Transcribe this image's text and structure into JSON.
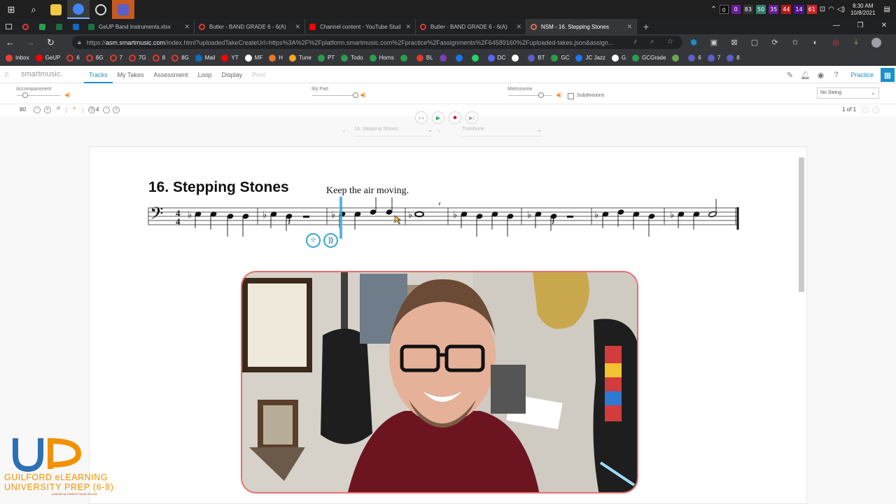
{
  "taskbar": {
    "tray_badges": [
      "0",
      "0",
      "83",
      "50",
      "35",
      "44",
      "14",
      "61"
    ],
    "time": "8:30 AM",
    "date": "10/8/2021"
  },
  "tabs": [
    {
      "title": "GeUP Band Instruments.xlsx",
      "color": "#1d6f42"
    },
    {
      "title": "Butler - BAND GRADE 6 - 6(A)",
      "color": "#e0392c"
    },
    {
      "title": "Channel content - YouTube Stud",
      "color": "#ff0000"
    },
    {
      "title": "Butler - BAND GRADE 6 - 6(A)",
      "color": "#e0392c"
    },
    {
      "title": "NSM - 16. Stepping Stones",
      "color": "#e06e4a",
      "active": true
    }
  ],
  "address": {
    "host": "asm.smartmusic.com",
    "prefix": "https://",
    "path": "/index.html?uploadedTakeCreateUrl=https%3A%2F%2Fplatform.smartmusic.com%2Fpractice%2Fassignments%2F64589160%2Fuploaded-takes.json&assign..."
  },
  "bookmarks": [
    {
      "label": "Inbox",
      "color": "#ea4335"
    },
    {
      "label": "GeUP",
      "color": "#ff0000"
    },
    {
      "label": "6",
      "color": "#e0392c",
      "ring": true
    },
    {
      "label": "6G",
      "color": "#e0392c",
      "ring": true
    },
    {
      "label": "7",
      "color": "#e0392c",
      "ring": true
    },
    {
      "label": "7G",
      "color": "#e0392c",
      "ring": true
    },
    {
      "label": "8",
      "color": "#e0392c",
      "ring": true
    },
    {
      "label": "8G",
      "color": "#e0392c",
      "ring": true
    },
    {
      "label": "Mail",
      "color": "#0f6cbd"
    },
    {
      "label": "YT",
      "color": "#ff0000"
    },
    {
      "label": "MF",
      "color": "#ffffff"
    },
    {
      "label": "H",
      "color": "#e87722"
    },
    {
      "label": "Tune",
      "color": "#f5a623"
    },
    {
      "label": "PT",
      "color": "#2a9d4b"
    },
    {
      "label": "Todo",
      "color": "#2a9d4b"
    },
    {
      "label": "Horns",
      "color": "#2a9d4b"
    },
    {
      "label": "",
      "color": "#2a9d4b"
    },
    {
      "label": "BL",
      "color": "#e0392c"
    },
    {
      "label": "",
      "color": "#7b3fb5"
    },
    {
      "label": "",
      "color": "#1877f2"
    },
    {
      "label": "",
      "color": "#25d366"
    },
    {
      "label": "DC",
      "color": "#5865f2"
    },
    {
      "label": "",
      "color": "#ffffff"
    },
    {
      "label": "BT",
      "color": "#5b5fc7"
    },
    {
      "label": "GC",
      "color": "#2a9d4b"
    },
    {
      "label": "JC Jazz",
      "color": "#1877f2"
    },
    {
      "label": "G",
      "color": "#ffffff"
    },
    {
      "label": "GCGrade",
      "color": "#2a9d4b"
    },
    {
      "label": "",
      "color": "#6aa84f"
    },
    {
      "label": "6",
      "color": "#5b5fc7"
    },
    {
      "label": "7",
      "color": "#5b5fc7"
    },
    {
      "label": "8",
      "color": "#5b5fc7"
    }
  ],
  "app": {
    "logo": "smartmusic.",
    "nav": [
      {
        "label": "Tracks",
        "active": true
      },
      {
        "label": "My Takes"
      },
      {
        "label": "Assessment"
      },
      {
        "label": "Loop"
      },
      {
        "label": "Display"
      },
      {
        "label": "Print",
        "disabled": true
      }
    ],
    "practice_label": "Practice"
  },
  "mixer": {
    "accompaniment_label": "Accompaniment",
    "mypart_label": "My Part",
    "metronome_label": "Metronome",
    "subdivisions_label": "Subdivisions",
    "swing_value": "No Swing",
    "accompaniment_level": 0.2,
    "mypart_level": 1.0,
    "metronome_level": 0.75
  },
  "tempo": {
    "value": "80",
    "count_in": "4",
    "page_indicator": "1 of 1"
  },
  "selectors": {
    "piece": "16. Stepping Stones",
    "instrument": "Trombone"
  },
  "score": {
    "title": "16. Stepping Stones",
    "expression": "Keep the air moving.",
    "time_signature": [
      "4",
      "4"
    ]
  },
  "logo": {
    "line1": "GUILFORD eLEARNING",
    "line2": "UNIVERSITY PREP (6-8)",
    "line3": "powered by Guilford County Schools"
  }
}
